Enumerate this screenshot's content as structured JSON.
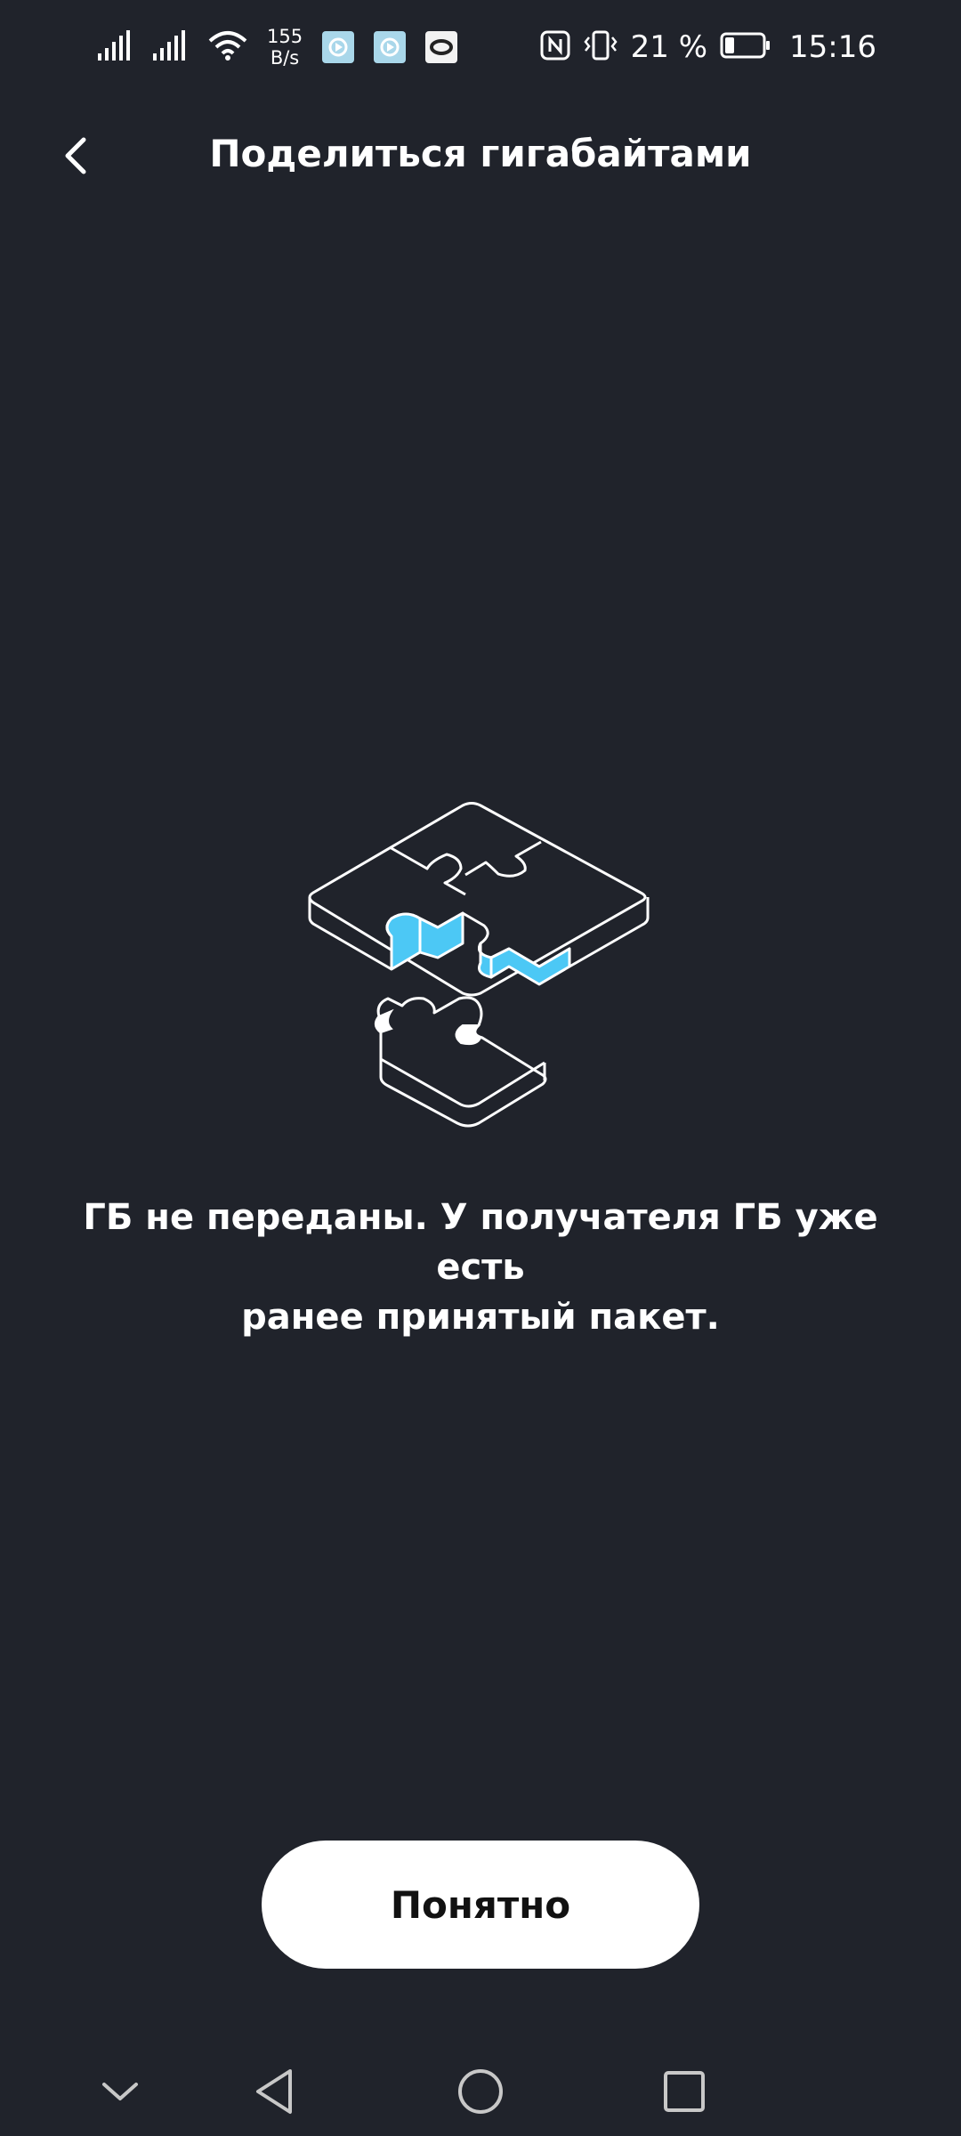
{
  "status_bar": {
    "net_speed_value": "155",
    "net_speed_unit": "B/s",
    "battery_percent": "21 %",
    "time": "15:16",
    "icons": [
      "signal-icon",
      "signal-icon",
      "wifi-icon",
      "app-icon",
      "app-icon",
      "app-icon",
      "nfc-icon",
      "vibrate-icon",
      "battery-icon"
    ]
  },
  "header": {
    "title": "Поделиться гигабайтами",
    "back_icon": "chevron-left-icon"
  },
  "illustration": {
    "icon": "puzzle-illustration",
    "accent_color": "#4cc8f5"
  },
  "message": {
    "line1": "ГБ не переданы. У получателя ГБ уже есть",
    "line2": "ранее принятый пакет."
  },
  "button": {
    "label": "Понятно"
  },
  "nav_bar": {
    "icons": [
      "chevron-down-icon",
      "back-triangle-icon",
      "home-circle-icon",
      "recents-square-icon"
    ]
  },
  "colors": {
    "background": "#20232b",
    "text": "#ffffff",
    "button_bg": "#ffffff",
    "button_text": "#111111",
    "accent": "#4cc8f5"
  }
}
